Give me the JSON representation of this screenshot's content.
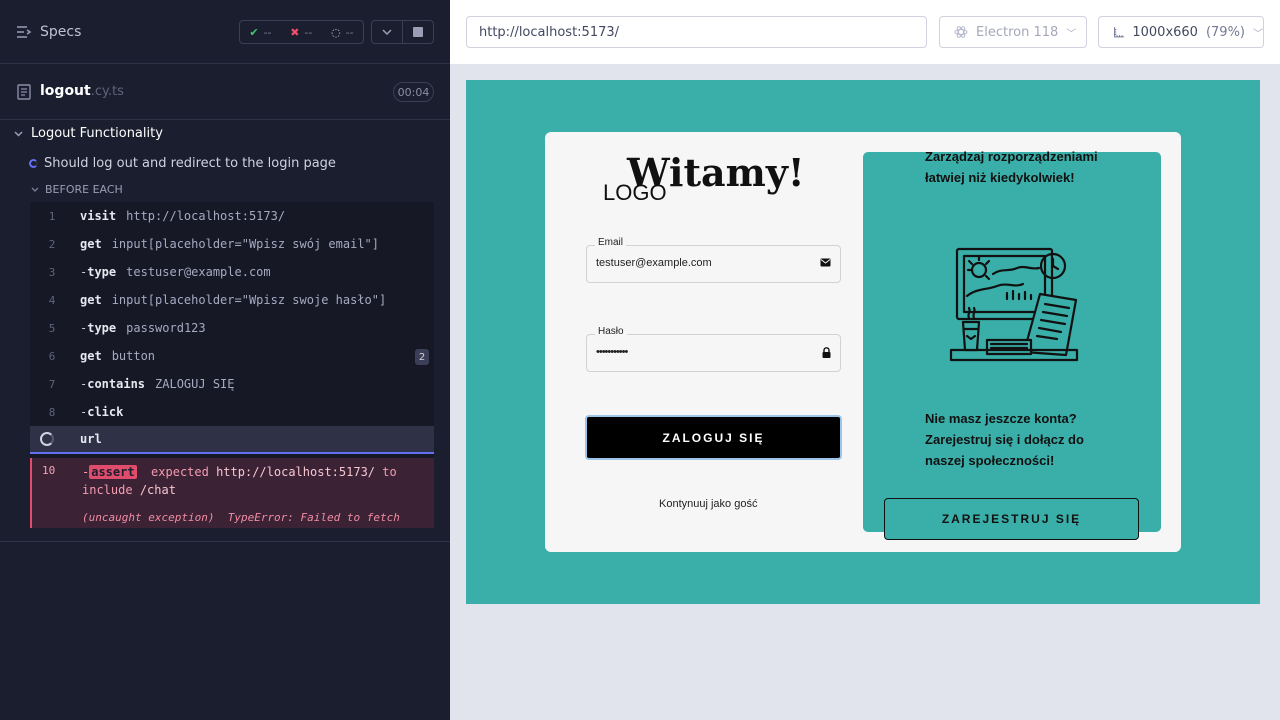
{
  "runner": {
    "specs_label": "Specs",
    "stats": {
      "passed": "--",
      "failed": "--",
      "pending": "--"
    },
    "file": {
      "name": "logout",
      "ext": ".cy.ts",
      "duration": "00:04"
    },
    "suite": "Logout Functionality",
    "test": "Should log out and redirect to the login page",
    "hook": "BEFORE EACH",
    "commands": [
      {
        "num": "1",
        "name": "visit",
        "arg": "http://localhost:5173/",
        "child": false
      },
      {
        "num": "2",
        "name": "get",
        "arg": "input[placeholder=\"Wpisz swój email\"]",
        "child": false
      },
      {
        "num": "3",
        "name": "type",
        "arg": "testuser@example.com",
        "child": true
      },
      {
        "num": "4",
        "name": "get",
        "arg": "input[placeholder=\"Wpisz swoje hasło\"]",
        "child": false
      },
      {
        "num": "5",
        "name": "type",
        "arg": "password123",
        "child": true
      },
      {
        "num": "6",
        "name": "get",
        "arg": "button",
        "child": false,
        "badge": "2"
      },
      {
        "num": "7",
        "name": "contains",
        "arg": "ZALOGUJ SIĘ",
        "child": true
      },
      {
        "num": "8",
        "name": "click",
        "arg": "",
        "child": true
      }
    ],
    "active_command": "url",
    "error": {
      "num": "10",
      "tag": "assert",
      "expected": "expected",
      "url": "http://localhost:5173/",
      "to": "to",
      "include": "include",
      "path": "/chat",
      "exception": "(uncaught exception)",
      "message": "TypeError: Failed to fetch"
    }
  },
  "browser": {
    "url": "http://localhost:5173/",
    "browser_name": "Electron 118",
    "viewport": "1000x660",
    "zoom": "(79%)"
  },
  "app": {
    "title": "Witamy!",
    "logo": "LOGO",
    "email_label": "Email",
    "email_value": "testuser@example.com",
    "password_label": "Hasło",
    "password_value": "•••••••••••",
    "login_button": "ZALOGUJ SIĘ",
    "guest_link": "Kontynuuj jako gość",
    "promo_text": "Zarządzaj rozporządzeniami łatwiej niż kiedykolwiek!",
    "register_prompt": "Nie masz jeszcze konta? Zarejestruj się i dołącz do naszej społeczności!",
    "register_button": "ZAREJESTRUJ SIĘ",
    "colors": {
      "accent": "#3aaea8",
      "button": "#000000"
    }
  }
}
